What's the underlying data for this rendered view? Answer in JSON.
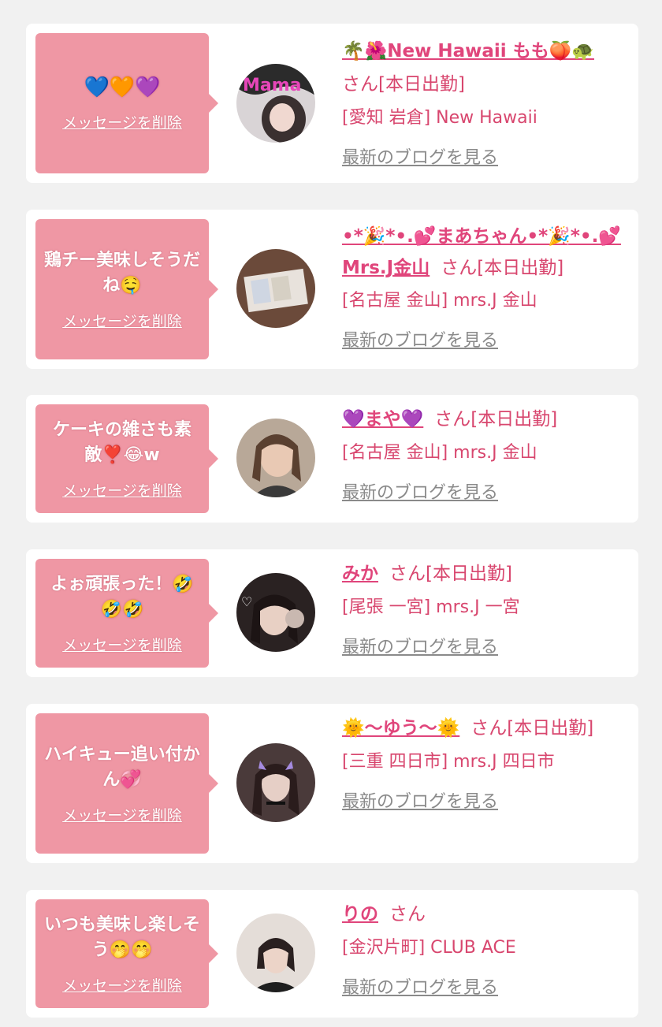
{
  "delete_label": "メッセージを削除",
  "san_suffix": "さん",
  "working_suffix": "[本日出勤]",
  "blog_label": "最新のブログを見る",
  "cards": [
    {
      "message": "💙🧡💜",
      "name": "🌴🌺New Hawaii もも🍑🐢",
      "status": "さん[本日出勤]",
      "shop": "[愛知 岩倉] New Hawaii"
    },
    {
      "message": "鶏チー美味しそうだね🤤",
      "name": "•*🎉*•.💕まあちゃん•*🎉*•.💕Mrs.J金山",
      "status": "さん[本日出勤]",
      "shop": "[名古屋 金山] mrs.J 金山"
    },
    {
      "message": "ケーキの雑さも素敵❣️😂w",
      "name": "💜まや💜",
      "status": "さん[本日出勤]",
      "shop": "[名古屋 金山] mrs.J 金山"
    },
    {
      "message": "よぉ頑張った！🤣🤣🤣",
      "name": "みか",
      "status": "さん[本日出勤]",
      "shop": "[尾張 一宮] mrs.J 一宮"
    },
    {
      "message": "ハイキュー追い付かん💞",
      "name": "🌞〜ゆう〜🌞",
      "status": "さん[本日出勤]",
      "shop": "[三重 四日市] mrs.J 四日市"
    },
    {
      "message": "いつも美味し楽しそう🤭🤭",
      "name": "りの",
      "status": "さん",
      "shop": "[金沢片町] CLUB ACE"
    }
  ],
  "colors": {
    "bubble": "#ef97a4",
    "name": "#e0457b",
    "meta": "#d8466e",
    "blog": "#8a8a8a"
  }
}
